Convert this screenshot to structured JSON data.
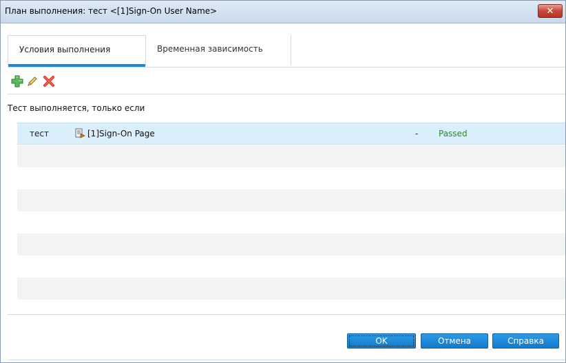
{
  "window": {
    "title": "План выполнения: тест <[1]Sign-On User Name>",
    "close_symbol": "✕"
  },
  "tabs": [
    {
      "label": "Условия выполнения",
      "active": true
    },
    {
      "label": "Временная зависимость",
      "active": false
    }
  ],
  "toolbar": {
    "add_icon": "plus-icon",
    "edit_icon": "pencil-icon",
    "delete_icon": "delete-x-icon"
  },
  "caption": "Тест выполняется, только если",
  "conditions": [
    {
      "name": "тест",
      "target": "[1]Sign-On Page",
      "separator": "-",
      "status": "Passed",
      "target_icon": "test-instance-icon"
    }
  ],
  "buttons": {
    "ok": "OK",
    "cancel": "Отмена",
    "help": "Справка"
  },
  "colors": {
    "accent": "#1e88d8",
    "selected_row": "#dbeefb",
    "status_passed": "#2a8a2a",
    "button": "#1a86d6"
  }
}
